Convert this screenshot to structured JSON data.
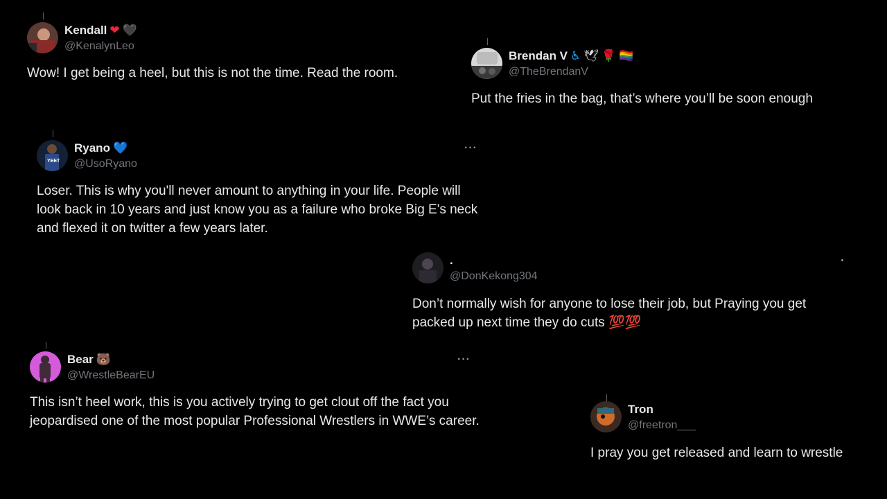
{
  "colors": {
    "background": "#000000",
    "text_primary": "#e7e9ea",
    "text_secondary": "#71767b"
  },
  "tweets": [
    {
      "display_name": "Kendall",
      "name_badges": [
        "❤",
        "🖤"
      ],
      "handle": "@KenalynLeo",
      "text": "Wow! I get being a heel, but this is not the time. Read the room.",
      "avatar": "profile-photo-icon"
    },
    {
      "display_name": "Brendan V",
      "name_badges": [
        "♿",
        "🕊",
        "🌹",
        "🏳️‍🌈"
      ],
      "handle": "@TheBrendanV",
      "text": "Put the fries in the bag, that’s where you’ll be soon enough",
      "avatar": "profile-photo-icon"
    },
    {
      "display_name": "Ryano",
      "name_badges": [
        "💙"
      ],
      "handle": "@UsoRyano",
      "text": "Loser. This is why you'll never amount to anything in your life. People will look back in 10 years and just know you as a failure who broke Big E's neck and flexed it on twitter a few years later.",
      "more_label": "···",
      "avatar": "profile-photo-icon"
    },
    {
      "display_name": ".",
      "name_badges": [],
      "handle": "@DonKekong304",
      "text": "Don’t normally wish for anyone to lose their job, but Praying you get packed up next time they do cuts 💯💯",
      "avatar": "profile-photo-icon"
    },
    {
      "display_name": "Bear",
      "name_badges": [
        "🐻"
      ],
      "handle": "@WrestleBearEU",
      "text": "This isn’t heel work, this is you actively trying to get clout off the fact you jeopardised one of the most popular Professional Wrestlers in WWE’s career.",
      "more_label": "···",
      "avatar": "profile-photo-icon"
    },
    {
      "display_name": "Tron",
      "name_badges": [],
      "handle": "@freetron___",
      "text": "I pray you get released and learn to wrestle",
      "avatar": "profile-photo-icon"
    }
  ]
}
